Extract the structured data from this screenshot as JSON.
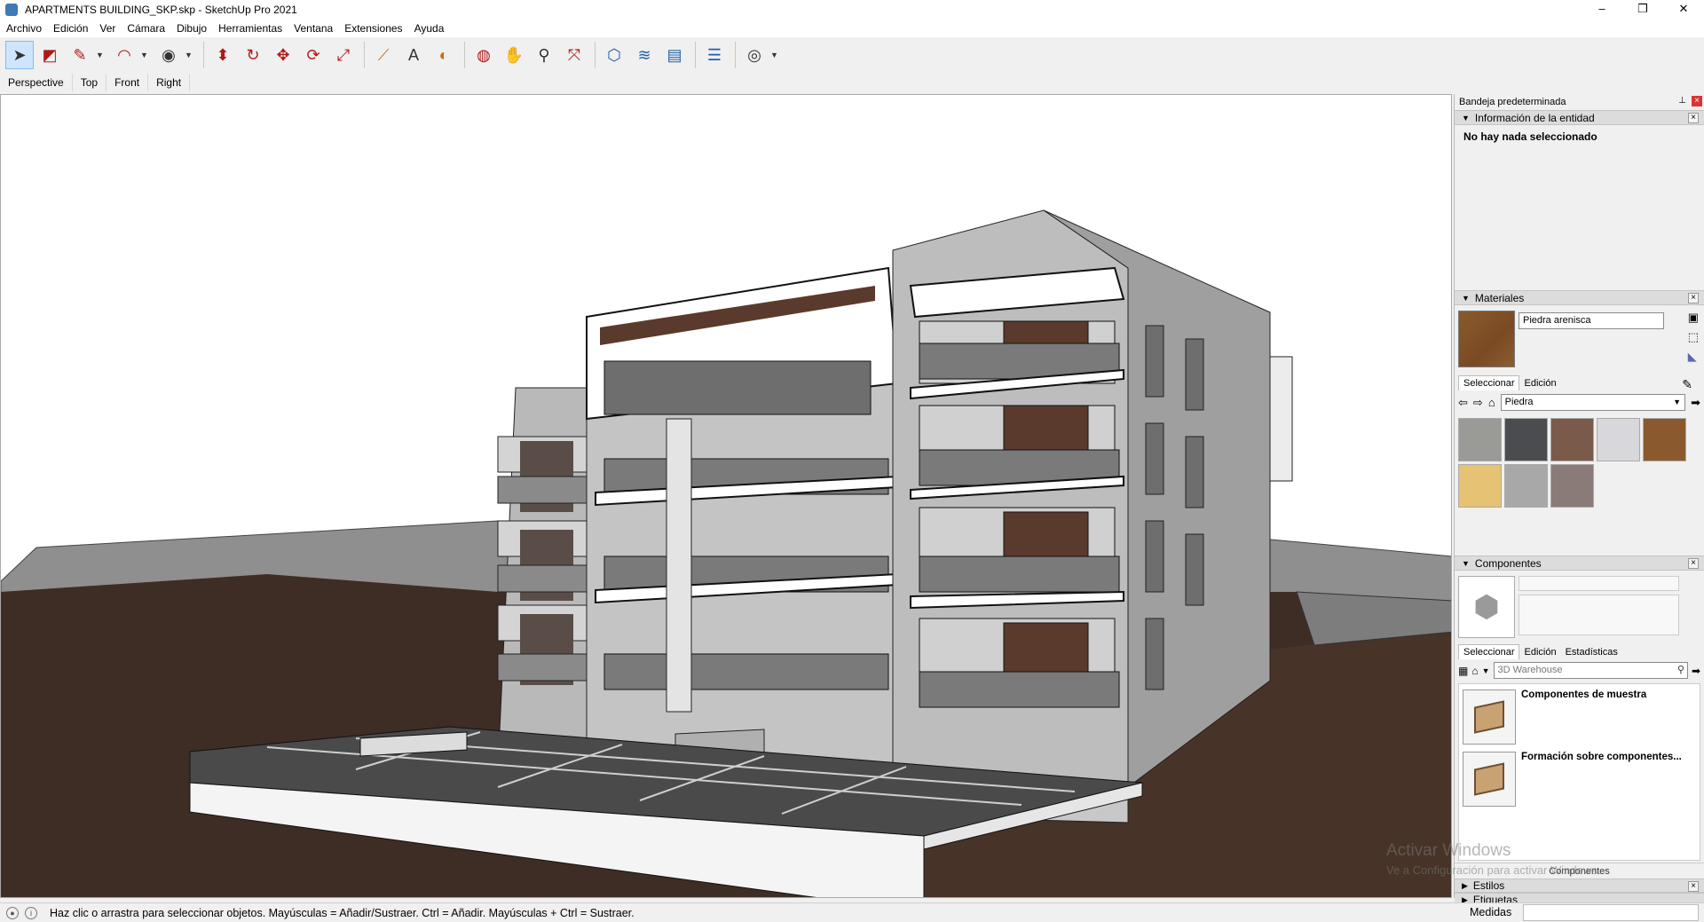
{
  "window": {
    "title": "APARTMENTS BUILDING_SKP.skp - SketchUp Pro 2021",
    "minimize": "–",
    "maximize": "❐",
    "close": "✕"
  },
  "menu": [
    "Archivo",
    "Edición",
    "Ver",
    "Cámara",
    "Dibujo",
    "Herramientas",
    "Ventana",
    "Extensiones",
    "Ayuda"
  ],
  "scene_tabs": [
    "Perspective",
    "Top",
    "Front",
    "Right"
  ],
  "tray": {
    "title": "Bandeja predeterminada",
    "entity_info": {
      "header": "Información de la entidad",
      "message": "No hay nada seleccionado"
    },
    "materials": {
      "header": "Materiales",
      "current_name": "Piedra arenisca",
      "tabs": [
        "Seleccionar",
        "Edición"
      ],
      "library": "Piedra",
      "swatch_colors": [
        "#9a9a96",
        "#4a4c4f",
        "#7a5a4a",
        "#d8d8dc",
        "#8a5a2e",
        "#e6c274",
        "#a9a8a8",
        "#8a7a78"
      ]
    },
    "components": {
      "header": "Componentes",
      "tabs": [
        "Seleccionar",
        "Edición",
        "Estadísticas"
      ],
      "search_placeholder": "3D Warehouse",
      "items": [
        "Componentes de muestra",
        "Formación sobre componentes..."
      ],
      "footer": "Componentes"
    },
    "collapsed_panels": [
      "Estilos",
      "Etiquetas"
    ]
  },
  "status": {
    "hint": "Haz clic o arrastra para seleccionar objetos. Mayúsculas = Añadir/Sustraer. Ctrl = Añadir. Mayúsculas + Ctrl = Sustraer.",
    "measurements_label": "Medidas"
  },
  "watermark": {
    "line1": "Activar Windows",
    "line2": "Ve a Configuración para activar Windows."
  }
}
